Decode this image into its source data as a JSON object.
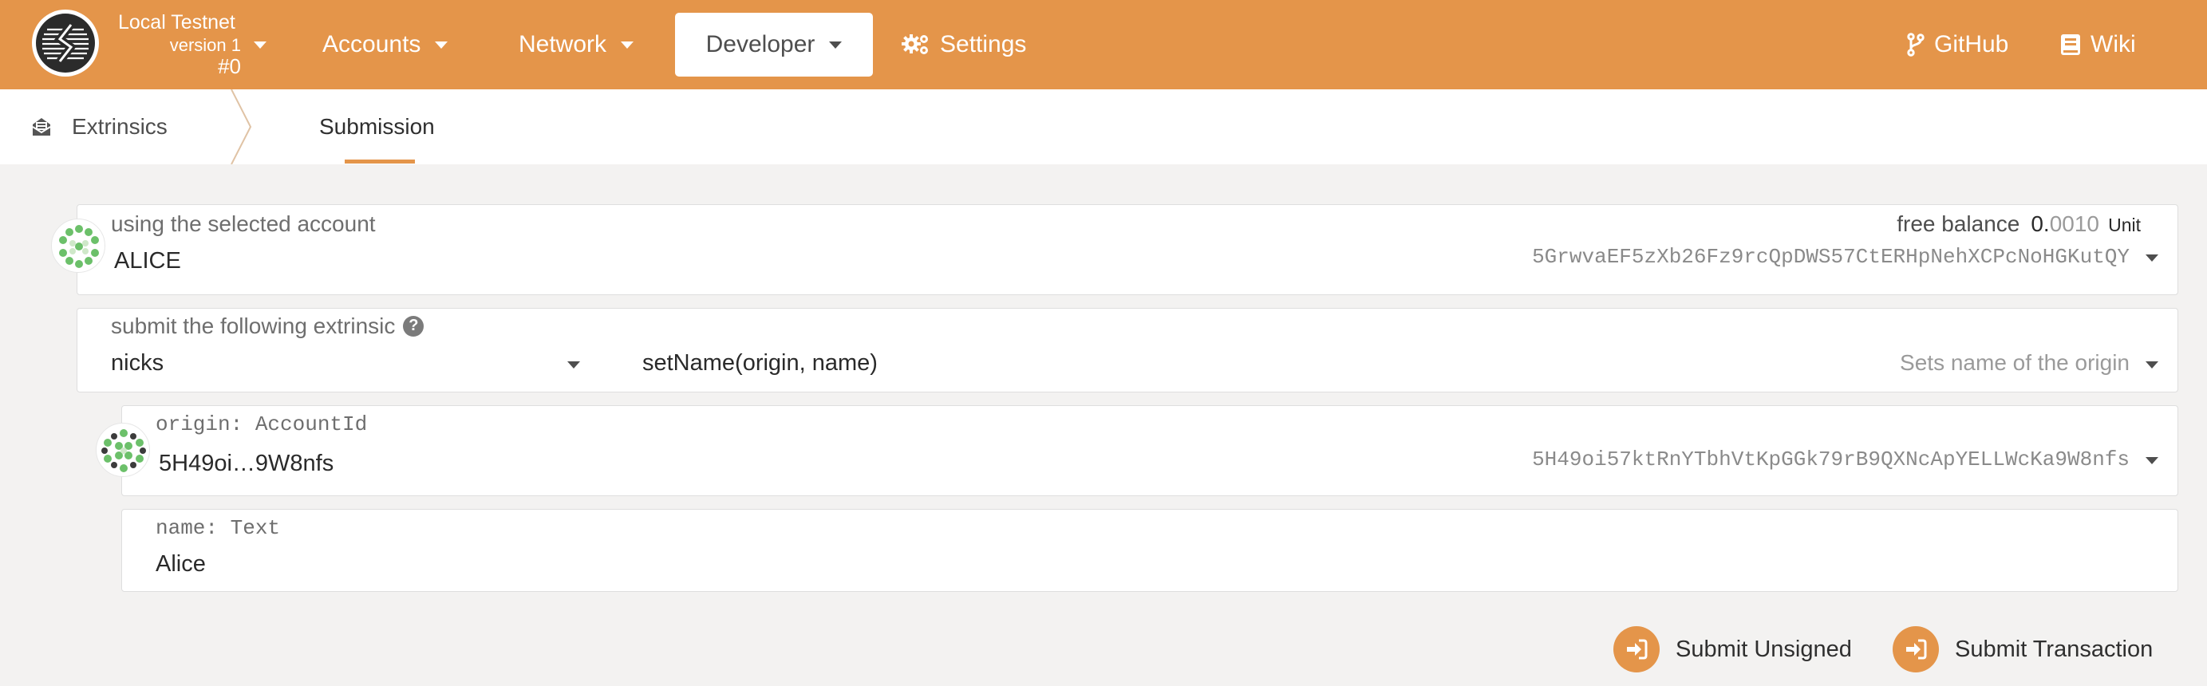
{
  "header": {
    "chain_name": "Local Testnet",
    "chain_version": "version 1",
    "chain_block": "#0",
    "nav": {
      "accounts": "Accounts",
      "network": "Network",
      "developer": "Developer",
      "settings": "Settings",
      "github": "GitHub",
      "wiki": "Wiki"
    },
    "accent_color": "#e4954a"
  },
  "tabs": {
    "extrinsics": "Extrinsics",
    "submission": "Submission",
    "active": "Submission"
  },
  "account": {
    "label": "using the selected account",
    "name": "ALICE",
    "balance_label": "free balance",
    "balance_int": "0.",
    "balance_frac": "0010",
    "balance_unit": "Unit",
    "address": "5GrwvaEF5zXb26Fz9rcQpDWS57CtERHpNehXCPcNoHGKutQY"
  },
  "extrinsic": {
    "label": "submit the following extrinsic",
    "help_glyph": "?",
    "module": "nicks",
    "method": "setName(origin, name)",
    "description": "Sets name of the origin"
  },
  "params": {
    "origin": {
      "label": "origin: AccountId",
      "short_address": "5H49oi…9W8nfs",
      "address": "5H49oi57ktRnYTbhVtKpGGk79rB9QXNcApYELLWcKa9W8nfs"
    },
    "name": {
      "label": "name: Text",
      "value": "Alice"
    }
  },
  "actions": {
    "submit_unsigned": "Submit Unsigned",
    "submit_transaction": "Submit Transaction"
  },
  "icons": [
    "substrate-logo-icon",
    "caret-down-icon",
    "cogs-icon",
    "code-branch-icon",
    "book-icon",
    "envelope-open-icon",
    "question-circle-icon",
    "identicon-icon",
    "sign-in-icon"
  ]
}
